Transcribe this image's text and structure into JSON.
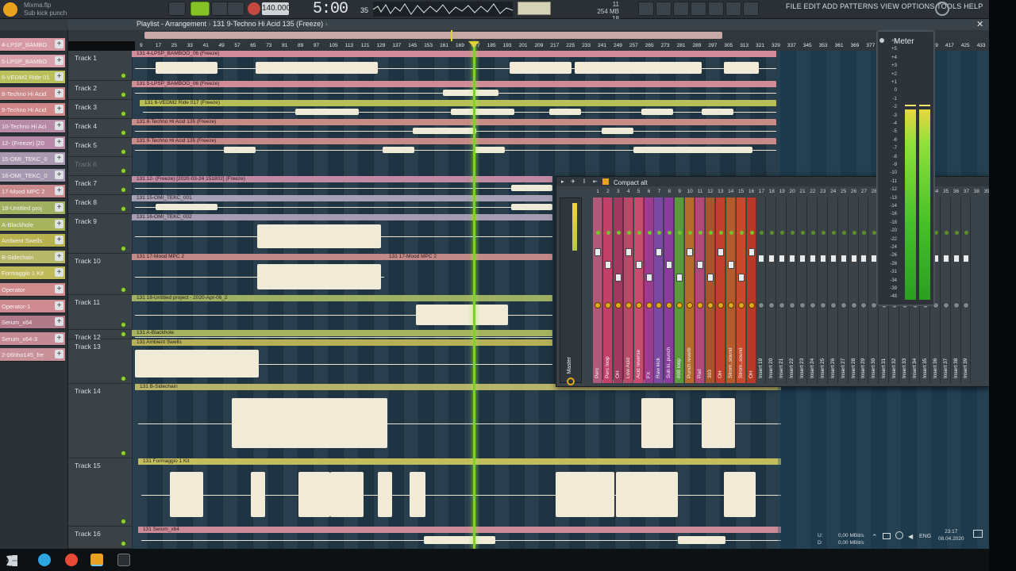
{
  "window": {
    "file": "Mixma.flp",
    "pattern_hint": "Sub kick punch",
    "tempo": "140.000",
    "time": "5:00",
    "time_small": "35",
    "cpu_mem": "254 MB",
    "cpu_num": "18",
    "cpu_top": "11",
    "menu": "FILE  EDIT  ADD  PATTERNS  VIEW  OPTIONS  TOOLS  HELP"
  },
  "playlist": {
    "title": "Playlist - Arrangement",
    "breadcrumb": "131 9-Techno Hi Acid 135 (Freeze)",
    "ruler": [
      "9",
      "17",
      "25",
      "33",
      "41",
      "49",
      "57",
      "65",
      "73",
      "81",
      "89",
      "97",
      "105",
      "113",
      "121",
      "129",
      "137",
      "145",
      "153",
      "161",
      "169",
      "177",
      "185",
      "193",
      "201",
      "209",
      "217",
      "225",
      "233",
      "241",
      "249",
      "257",
      "265",
      "273",
      "281",
      "289",
      "297",
      "305",
      "313",
      "321",
      "329",
      "337",
      "345",
      "353",
      "361",
      "369",
      "377",
      "385",
      "393",
      "401",
      "409",
      "417",
      "425",
      "433"
    ],
    "tracks": [
      {
        "name": "Track 1",
        "clip": "131 4-LPSP_BAMBOO_06 (Freeze)"
      },
      {
        "name": "Track 2",
        "clip": "131 5-LPSP_BAMBOO_06 (Freeze)"
      },
      {
        "name": "Track 3",
        "clip": "131 6-VEDM2 Ride 017 (Freeze)"
      },
      {
        "name": "Track 4",
        "clip": "131 8-Techno Hi Acid 135 (Freeze)"
      },
      {
        "name": "Track 5",
        "clip": "131 9-Techno Hi Acid 135 (Freeze)"
      },
      {
        "name": "Track 6",
        "clip": ""
      },
      {
        "name": "Track 7",
        "clip": "131 12- (Freeze) [2020-03-24 151802] (Freeze)"
      },
      {
        "name": "Track 8",
        "clip": "131 15-OMI_TEKC_001"
      },
      {
        "name": "Track 9",
        "clip": "131 16-OMI_TEKC_002"
      },
      {
        "name": "Track 10",
        "clip": "131 17-Mood MPC 2",
        "clip2": "131 17-Mood MPC 2"
      },
      {
        "name": "Track 11",
        "clip": "131 18-Untitled project - 2020-Apr-06_2"
      },
      {
        "name": "Track 12",
        "clip": "131 A-Blackhole"
      },
      {
        "name": "Track 13",
        "clip": "131 Ambient Swells"
      },
      {
        "name": "Track 14",
        "clip": "131 B-Sidechain"
      },
      {
        "name": "Track 15",
        "clip": "131 Formaggio 1 Kit"
      },
      {
        "name": "Track 16",
        "clip": "131 Serum_x64"
      }
    ]
  },
  "browser": {
    "items": [
      {
        "label": "4-LPSP_BAMBO",
        "color": "#d79aa5"
      },
      {
        "label": "5-LPSP_BAMBO",
        "color": "#d7a0aa"
      },
      {
        "label": "6-VEDM2 Ride 01",
        "color": "#b9c05a"
      },
      {
        "label": "8-Techno Hi Acid",
        "color": "#cc8a8a"
      },
      {
        "label": "9-Techno Hi Acid",
        "color": "#cf8686"
      },
      {
        "label": "10-Techno Hi Aci",
        "color": "#b78aa6"
      },
      {
        "label": "12- (Freeze) [20",
        "color": "#b88aa8"
      },
      {
        "label": "15-OMI_TEKC_0",
        "color": "#a898b0"
      },
      {
        "label": "16-OMI_TEKC_0",
        "color": "#a59ab2"
      },
      {
        "label": "17-Mood MPC 2",
        "color": "#c88a8c"
      },
      {
        "label": "18-Untitled proj",
        "color": "#a0b060"
      },
      {
        "label": "A-Blackhole",
        "color": "#a6b45c"
      },
      {
        "label": "Ambient Swells",
        "color": "#b7b14e"
      },
      {
        "label": "B-Sidechain",
        "color": "#b8b86a"
      },
      {
        "label": "Formaggio 1 Kit",
        "color": "#c0bb5a"
      },
      {
        "label": "Operator",
        "color": "#cf8a8c"
      },
      {
        "label": "Operator-1",
        "color": "#cf8a92"
      },
      {
        "label": "Serum_x64",
        "color": "#b07a8a"
      },
      {
        "label": "Serum_x64-3",
        "color": "#c48a96"
      },
      {
        "label": "2-06hho145_fre",
        "color": "#c89098"
      }
    ]
  },
  "mixer": {
    "title": "Compact alt",
    "master_label": "Master",
    "numbers": [
      "1",
      "2",
      "3",
      "4",
      "5",
      "6",
      "7",
      "8",
      "9",
      "10",
      "11",
      "12",
      "13",
      "14",
      "15",
      "16",
      "17",
      "18",
      "19",
      "20",
      "21",
      "22",
      "23",
      "24",
      "25",
      "26",
      "27",
      "28",
      "29",
      "30",
      "31",
      "32",
      "33",
      "34",
      "35",
      "36",
      "37",
      "38",
      "39"
    ],
    "channels": [
      {
        "label": "Perc",
        "color": "#b05a7a"
      },
      {
        "label": "Perc loop",
        "color": "#c2406a"
      },
      {
        "label": "OH",
        "color": "#9e3a5e"
      },
      {
        "label": "Low Acid",
        "color": "#b74a68"
      },
      {
        "label": "Acid reverse",
        "color": "#c84a6e"
      },
      {
        "label": "FX",
        "color": "#9b3d8f"
      },
      {
        "label": "Raw kick",
        "color": "#7a4aa0"
      },
      {
        "label": "Sub ki..punch",
        "color": "#8b3a9d"
      },
      {
        "label": "808 loop",
        "color": "#5a9a3a"
      },
      {
        "label": "Punch reverb",
        "color": "#b56a2e"
      },
      {
        "label": "Pad",
        "color": "#b0487a"
      },
      {
        "label": "303",
        "color": "#a8552a"
      },
      {
        "label": "OH",
        "color": "#c0402e"
      },
      {
        "label": "Strom..sound",
        "color": "#b55a2a"
      },
      {
        "label": "Strom..sound",
        "color": "#c84a2e"
      },
      {
        "label": "OH",
        "color": "#b8382a"
      },
      {
        "label": "Insert 19",
        "color": "#3b4349"
      },
      {
        "label": "Insert 20",
        "color": "#3b4349"
      },
      {
        "label": "Insert 21",
        "color": "#3b4349"
      },
      {
        "label": "Insert 22",
        "color": "#3b4349"
      },
      {
        "label": "Insert 23",
        "color": "#3b4349"
      },
      {
        "label": "Insert 24",
        "color": "#3b4349"
      },
      {
        "label": "Insert 25",
        "color": "#3b4349"
      },
      {
        "label": "Insert 26",
        "color": "#3b4349"
      },
      {
        "label": "Insert 27",
        "color": "#3b4349"
      },
      {
        "label": "Insert 28",
        "color": "#3b4349"
      },
      {
        "label": "Insert 29",
        "color": "#3b4349"
      },
      {
        "label": "Insert 30",
        "color": "#3b4349"
      },
      {
        "label": "Insert 31",
        "color": "#3b4349"
      },
      {
        "label": "Insert 32",
        "color": "#3b4349"
      },
      {
        "label": "Insert 33",
        "color": "#3b4349"
      },
      {
        "label": "Insert 34",
        "color": "#3b4349"
      },
      {
        "label": "Insert 35",
        "color": "#3b4349"
      },
      {
        "label": "Insert 36",
        "color": "#3b4349"
      },
      {
        "label": "Insert 37",
        "color": "#3b4349"
      },
      {
        "label": "Insert 38",
        "color": "#3b4349"
      },
      {
        "label": "Insert 39",
        "color": "#3b4349"
      }
    ]
  },
  "meter": {
    "title": "Meter",
    "scale": [
      "+6",
      "+5",
      "+4",
      "+3",
      "+2",
      "+1",
      "0",
      "-1",
      "-2",
      "-3",
      "-4",
      "-5",
      "-6",
      "-7",
      "-8",
      "-9",
      "-10",
      "-11",
      "-12",
      "-13",
      "-14",
      "-16",
      "-18",
      "-20",
      "-22",
      "-24",
      "-26",
      "-28",
      "-31",
      "-34",
      "-39",
      "-48"
    ]
  },
  "taskbar": {
    "net_up": "0,00 MBit/s",
    "net_down": "0,00 MBit/s",
    "net_u": "U:",
    "net_d": "D:",
    "lang": "ENG",
    "clock": "23:17",
    "date": "08.04.2020"
  }
}
